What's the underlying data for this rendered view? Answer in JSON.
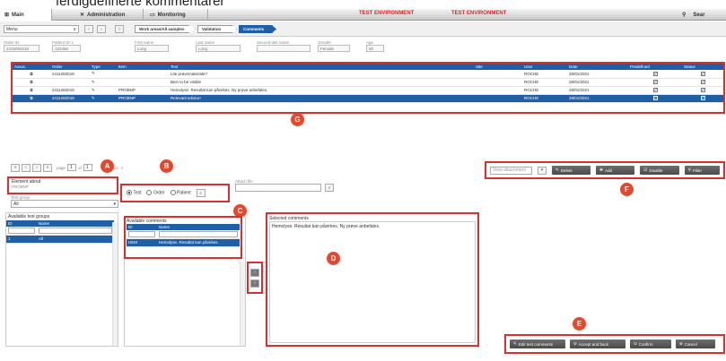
{
  "heading": "ferdigdefinerte kommentarer",
  "tabs": [
    {
      "label": "Main",
      "icon": "main-icon"
    },
    {
      "label": "Administration",
      "icon": "wrench-icon"
    },
    {
      "label": "Monitoring",
      "icon": "monitor-icon"
    }
  ],
  "test_env": [
    "TEST ENVIRONMENT",
    "TEST ENVIRONMENT"
  ],
  "search_label": "Sear",
  "menu_value": "Menu",
  "breadcrumbs": [
    "Work areas/All samples",
    "Validation",
    "Comments"
  ],
  "patient_fields": [
    {
      "label": "Order ID",
      "value": "2415092018"
    },
    {
      "label": "Patient ID 1",
      "value": "123456"
    },
    {
      "label": "First name",
      "value": "Long"
    },
    {
      "label": "Last name",
      "value": "Long"
    },
    {
      "label": "Second last name",
      "value": ""
    },
    {
      "label": "Gender",
      "value": "Female"
    },
    {
      "label": "Age",
      "value": "50"
    }
  ],
  "comments_table": {
    "columns": [
      "Assoc.",
      "Order",
      "Type",
      "Item",
      "Text",
      "Site",
      "User",
      "Date",
      "Predefined",
      "Status"
    ],
    "rows": [
      {
        "order": "2411282018",
        "item": "",
        "text": "Lite prøvemateriale?",
        "user": "ROCHE",
        "date": "28/01/2021",
        "selected": false
      },
      {
        "order": "",
        "item": "",
        "text": "Bein to be visible",
        "user": "ROCHE",
        "date": "28/01/2021",
        "selected": false
      },
      {
        "order": "2411282018",
        "item": "PROBNP",
        "text": "Hemolyse. Resultat kan påvirkes. Ny prøve anbefales.",
        "user": "ROCHE",
        "date": "28/01/2021",
        "selected": false
      },
      {
        "order": "2411282018",
        "item": "PROBNP",
        "text": "Relevant tekstur!",
        "user": "ROCHE",
        "date": "28/01/2021",
        "selected": true
      }
    ]
  },
  "pagination": {
    "page_label": "page",
    "page": "1",
    "of_label": "of",
    "total": "1",
    "items_label": "tec: 4"
  },
  "element_about": {
    "label": "Element about",
    "value": "PROBNP"
  },
  "test_group_filter": {
    "label": "Test group",
    "value": "All"
  },
  "radio_options": [
    "Test",
    "Order",
    "Patient"
  ],
  "attach_file_label": "Attach file",
  "available_groups": {
    "title": "Available test groups",
    "columns": [
      "ID",
      "Name"
    ],
    "rows": [
      {
        "id": "1",
        "name": "All"
      }
    ]
  },
  "available_comments": {
    "title": "Available comments",
    "columns": [
      "ID",
      "Name"
    ],
    "rows": [
      {
        "id": "HEM",
        "name": "Hemolyse. Resultat kan påvirkes."
      }
    ]
  },
  "selected_comments": {
    "title": "Selected comments",
    "text": "Hemolyse. Resultat kan påvirkes. Ny prøve anbefales."
  },
  "toolbar_f": {
    "view_attachment": "View attachment",
    "buttons": [
      "Delete",
      "Add",
      "Disable",
      "Filter"
    ]
  },
  "footer_buttons": [
    "Edit test comments",
    "Accept and back",
    "Confirm",
    "Cancel"
  ],
  "badges": [
    "A",
    "B",
    "C",
    "D",
    "E",
    "F",
    "G"
  ],
  "colors": {
    "accent": "#1f5fa8",
    "highlight_box": "#d9302f",
    "badge": "#e04a2f",
    "test_env": "#e0201f"
  }
}
